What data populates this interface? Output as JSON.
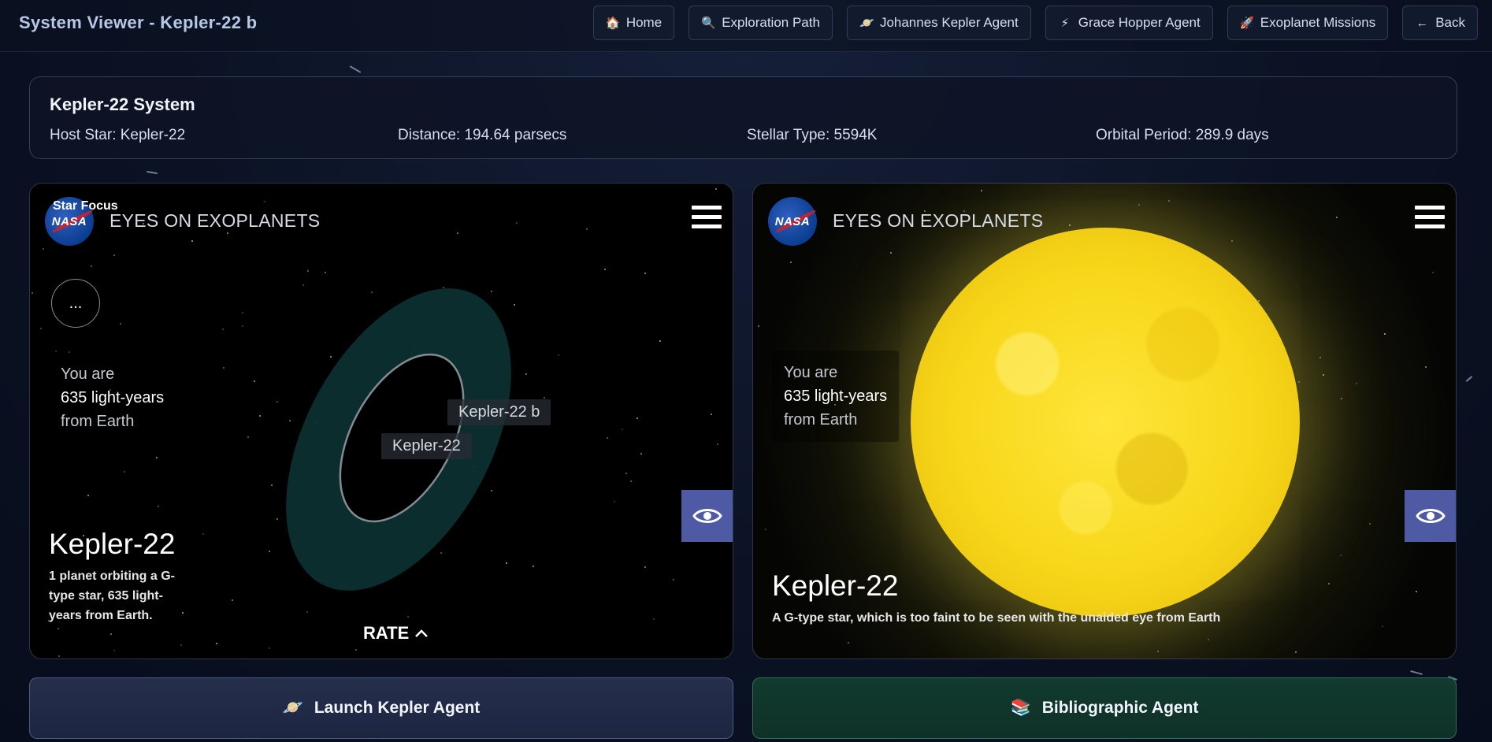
{
  "header": {
    "title": "System Viewer - Kepler-22 b",
    "nav": [
      {
        "icon": "🏠",
        "label": "Home"
      },
      {
        "icon": "🔍",
        "label": "Exploration Path"
      },
      {
        "icon": "🪐",
        "label": "Johannes Kepler Agent"
      },
      {
        "icon": "⚡",
        "label": "Grace Hopper Agent"
      },
      {
        "icon": "🚀",
        "label": "Exoplanet Missions"
      },
      {
        "icon": "←",
        "label": "Back"
      }
    ]
  },
  "system": {
    "title": "Kepler-22 System",
    "host_star": "Host Star: Kepler-22",
    "distance": "Distance: 194.64 parsecs",
    "stellar_type": "Stellar Type: 5594K",
    "orbital_period": "Orbital Period: 289.9 days"
  },
  "left_panel": {
    "focus_label": "Star Focus",
    "logo_text": "NASA",
    "app_title": "EYES ON EXOPLANETS",
    "more_label": "...",
    "distance_line1": "You are",
    "distance_line2": "635 light-years",
    "distance_line3": "from Earth",
    "planet_tag": "Kepler-22 b",
    "star_tag": "Kepler-22",
    "star_name": "Kepler-22",
    "star_desc": "1 planet orbiting a G-type star, 635 light-years from Earth.",
    "rate_label": "RATE",
    "colors": {
      "habitable_zone": "#0c2f30",
      "eye_button": "#4f5aa5"
    }
  },
  "right_panel": {
    "logo_text": "NASA",
    "app_title": "EYES ON EXOPLANETS",
    "distance_line1": "You are",
    "distance_line2": "635 light-years",
    "distance_line3": "from Earth",
    "star_name": "Kepler-22",
    "star_desc": "A G-type star, which is too faint to be seen with the unaided eye from Earth",
    "colors": {
      "star": "#ffe53a"
    }
  },
  "actions": {
    "kepler_icon": "🪐",
    "kepler_label": "Launch Kepler Agent",
    "biblio_icon": "📚",
    "biblio_label": "Bibliographic Agent"
  }
}
